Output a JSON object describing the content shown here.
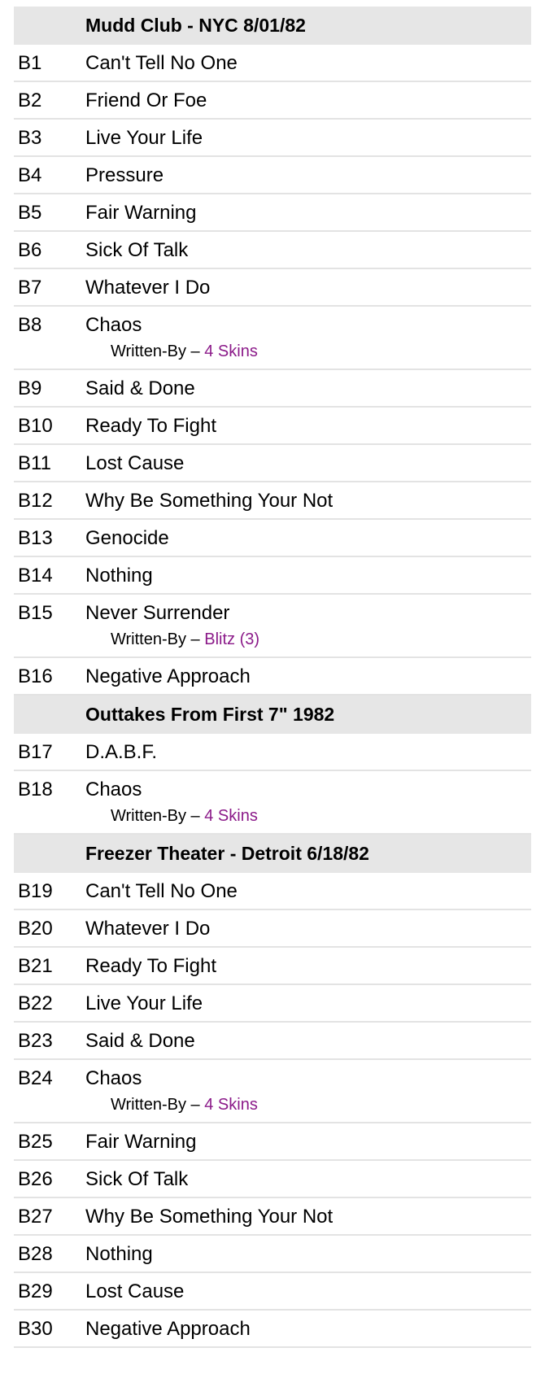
{
  "colors": {
    "header_bg": "#e6e6e6",
    "link": "#8b1a89",
    "divider": "#e3e3e3"
  },
  "sections": [
    {
      "heading": "Mudd Club - NYC 8/01/82",
      "tracks": [
        {
          "pos": "B1",
          "title": "Can't Tell No One"
        },
        {
          "pos": "B2",
          "title": "Friend Or Foe"
        },
        {
          "pos": "B3",
          "title": "Live Your Life"
        },
        {
          "pos": "B4",
          "title": "Pressure"
        },
        {
          "pos": "B5",
          "title": "Fair Warning"
        },
        {
          "pos": "B6",
          "title": "Sick Of Talk"
        },
        {
          "pos": "B7",
          "title": "Whatever I Do"
        },
        {
          "pos": "B8",
          "title": "Chaos",
          "credit_role": "Written-By –",
          "credit_artist": "4 Skins"
        },
        {
          "pos": "B9",
          "title": "Said & Done"
        },
        {
          "pos": "B10",
          "title": "Ready To Fight"
        },
        {
          "pos": "B11",
          "title": "Lost Cause"
        },
        {
          "pos": "B12",
          "title": "Why Be Something Your Not"
        },
        {
          "pos": "B13",
          "title": "Genocide"
        },
        {
          "pos": "B14",
          "title": "Nothing"
        },
        {
          "pos": "B15",
          "title": "Never Surrender",
          "credit_role": "Written-By –",
          "credit_artist": "Blitz (3)"
        },
        {
          "pos": "B16",
          "title": "Negative Approach"
        }
      ]
    },
    {
      "heading": "Outtakes From First 7\" 1982",
      "tracks": [
        {
          "pos": "B17",
          "title": "D.A.B.F."
        },
        {
          "pos": "B18",
          "title": "Chaos",
          "credit_role": "Written-By –",
          "credit_artist": "4 Skins"
        }
      ]
    },
    {
      "heading": "Freezer Theater - Detroit 6/18/82",
      "tracks": [
        {
          "pos": "B19",
          "title": "Can't Tell No One"
        },
        {
          "pos": "B20",
          "title": "Whatever I Do"
        },
        {
          "pos": "B21",
          "title": "Ready To Fight"
        },
        {
          "pos": "B22",
          "title": "Live Your Life"
        },
        {
          "pos": "B23",
          "title": "Said & Done"
        },
        {
          "pos": "B24",
          "title": "Chaos",
          "credit_role": "Written-By –",
          "credit_artist": "4 Skins"
        },
        {
          "pos": "B25",
          "title": "Fair Warning"
        },
        {
          "pos": "B26",
          "title": "Sick Of Talk"
        },
        {
          "pos": "B27",
          "title": "Why Be Something Your Not"
        },
        {
          "pos": "B28",
          "title": "Nothing"
        },
        {
          "pos": "B29",
          "title": "Lost Cause"
        },
        {
          "pos": "B30",
          "title": "Negative Approach"
        }
      ]
    }
  ]
}
